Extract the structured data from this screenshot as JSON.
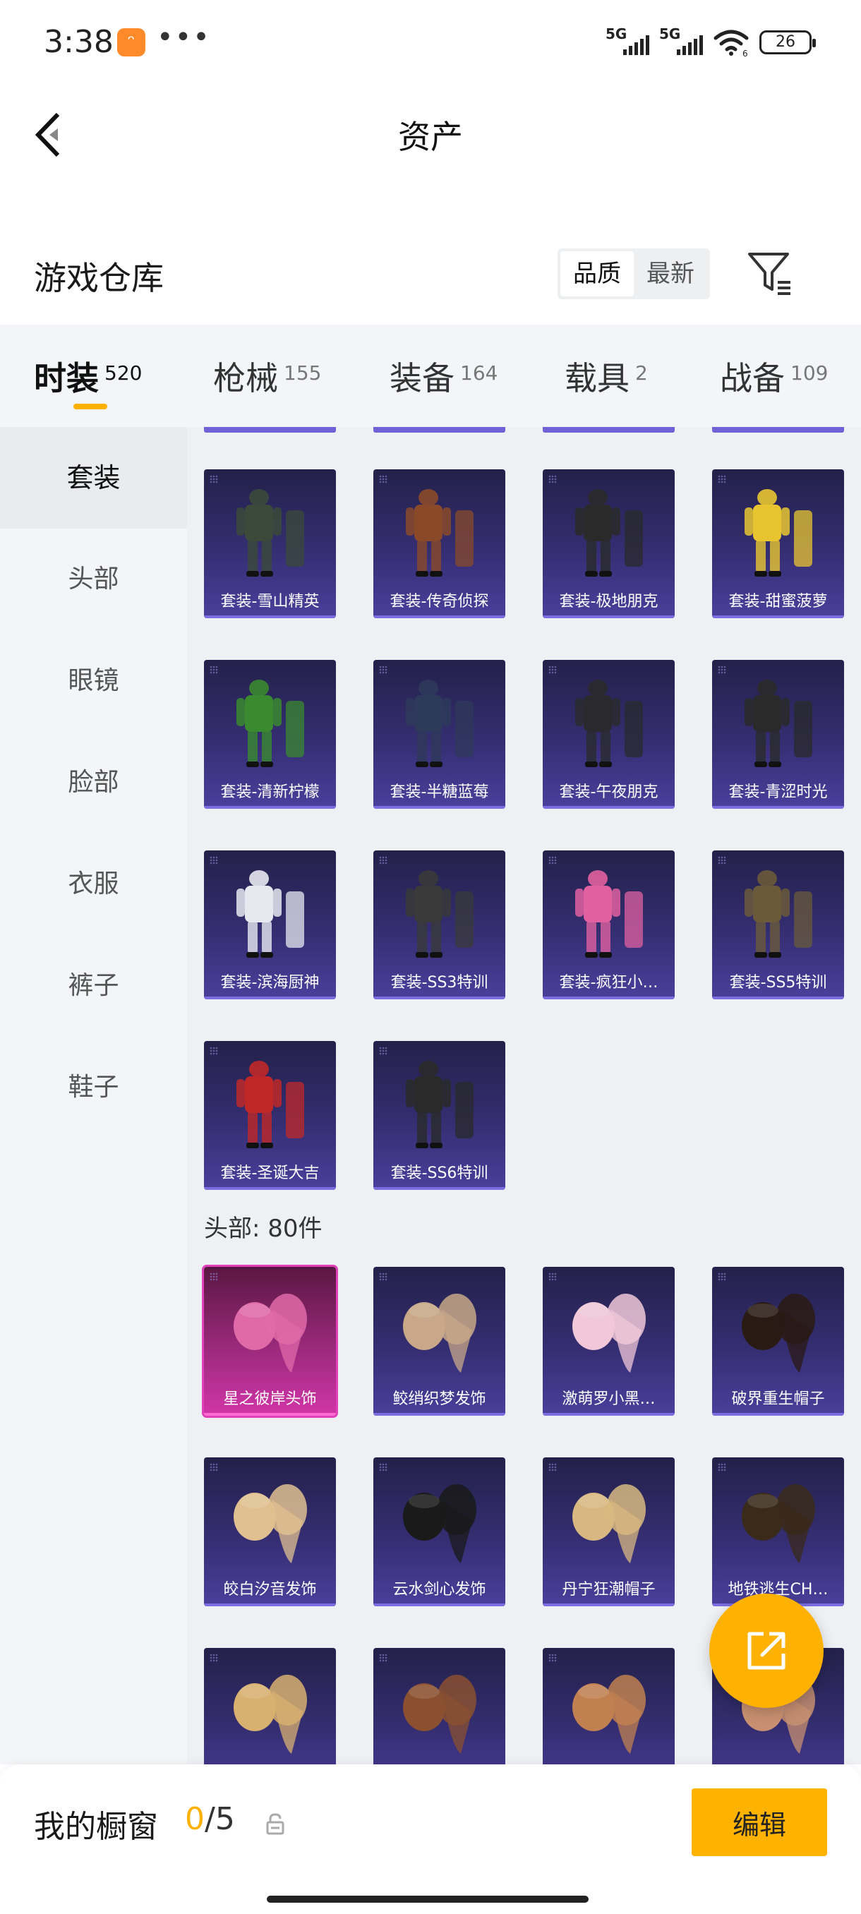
{
  "status": {
    "time": "3:38",
    "app_icon_glyph": "ᵔ",
    "dots": "•••",
    "sim1": "5G",
    "sim2": "5G",
    "battery": "26",
    "wifi_sub": "6"
  },
  "nav": {
    "title": "资产"
  },
  "warehouse": {
    "title": "游戏仓库",
    "sort": [
      "品质",
      "最新"
    ]
  },
  "tabs": [
    {
      "label": "时装",
      "count": "520"
    },
    {
      "label": "枪械",
      "count": "155"
    },
    {
      "label": "装备",
      "count": "164"
    },
    {
      "label": "载具",
      "count": "2"
    },
    {
      "label": "战备",
      "count": "109"
    }
  ],
  "sidebar": [
    "套装",
    "头部",
    "眼镜",
    "脸部",
    "衣服",
    "裤子",
    "鞋子"
  ],
  "suits": [
    {
      "label": "套装-雪山精英",
      "icon": "outfit-icon"
    },
    {
      "label": "套装-传奇侦探",
      "icon": "outfit-icon"
    },
    {
      "label": "套装-极地朋克",
      "icon": "outfit-icon"
    },
    {
      "label": "套装-甜蜜菠萝",
      "icon": "outfit-icon"
    },
    {
      "label": "套装-清新柠檬",
      "icon": "outfit-icon"
    },
    {
      "label": "套装-半糖蓝莓",
      "icon": "outfit-icon"
    },
    {
      "label": "套装-午夜朋克",
      "icon": "outfit-icon"
    },
    {
      "label": "套装-青涩时光",
      "icon": "outfit-icon"
    },
    {
      "label": "套装-滨海厨神",
      "icon": "outfit-icon"
    },
    {
      "label": "套装-SS3特训",
      "icon": "outfit-icon"
    },
    {
      "label": "套装-疯狂小…",
      "icon": "outfit-icon"
    },
    {
      "label": "套装-SS5特训",
      "icon": "outfit-icon"
    },
    {
      "label": "套装-圣诞大吉",
      "icon": "outfit-icon"
    },
    {
      "label": "套装-SS6特训",
      "icon": "outfit-icon"
    }
  ],
  "head_section_title": "头部: 80件",
  "heads": [
    {
      "label": "星之彼岸头饰",
      "icon": "headwear-icon"
    },
    {
      "label": "鲛绡织梦发饰",
      "icon": "headwear-icon"
    },
    {
      "label": "激萌罗小黑…",
      "icon": "headwear-icon"
    },
    {
      "label": "破界重生帽子",
      "icon": "headwear-icon"
    },
    {
      "label": "皎白汐音发饰",
      "icon": "headwear-icon"
    },
    {
      "label": "云水剑心发饰",
      "icon": "headwear-icon"
    },
    {
      "label": "丹宁狂潮帽子",
      "icon": "headwear-icon"
    },
    {
      "label": "地铁逃生CH…",
      "icon": "headwear-icon"
    },
    {
      "label": "",
      "icon": "headwear-icon"
    },
    {
      "label": "",
      "icon": "headwear-icon"
    },
    {
      "label": "",
      "icon": "headwear-icon"
    },
    {
      "label": "",
      "icon": "headwear-icon"
    }
  ],
  "showcase": {
    "title": "我的橱窗",
    "used": "0",
    "total": "/5",
    "edit_label": "编辑"
  },
  "colors": {
    "accent": "#ffb100",
    "card_bg": "#352e72",
    "card_highlight": "#d235a8"
  }
}
